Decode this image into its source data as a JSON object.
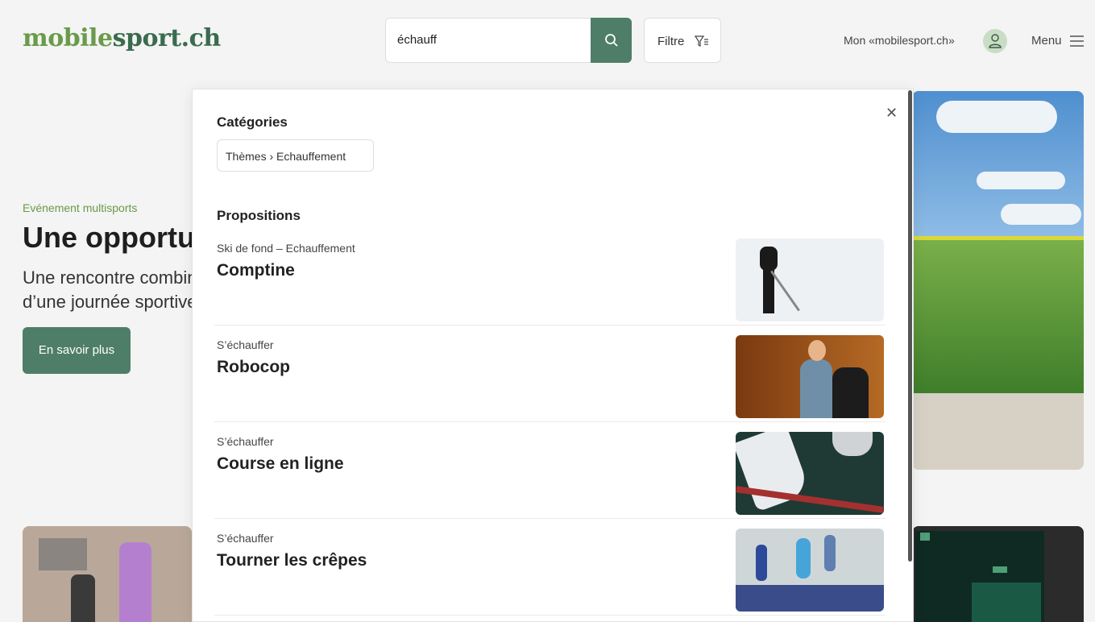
{
  "header": {
    "logo_part1": "mobile",
    "logo_part2": "sport.ch",
    "search_value": "échauff",
    "filter_label": "Filtre",
    "account_label": "Mon «mobilesport.ch»",
    "menu_label": "Menu"
  },
  "hero": {
    "kicker": "Evénement multisports",
    "title": "Une opportunité",
    "text_line1": "Une rencontre combinée",
    "text_line2": "d’une journée sportive",
    "button_label": "En savoir plus"
  },
  "dropdown": {
    "categories_title": "Catégories",
    "category_chip": "Thèmes › Echauffement",
    "suggestions_title": "Propositions",
    "suggestions": [
      {
        "category": "Ski de fond – Echauffement",
        "title": "Comptine"
      },
      {
        "category": "S’échauffer",
        "title": "Robocop"
      },
      {
        "category": "S’échauffer",
        "title": "Course en ligne"
      },
      {
        "category": "S’échauffer",
        "title": "Tourner les crêpes"
      }
    ]
  },
  "colors": {
    "brand_green": "#4f7e68",
    "logo_light": "#6a9a4a",
    "logo_dark": "#3a6b4f"
  }
}
